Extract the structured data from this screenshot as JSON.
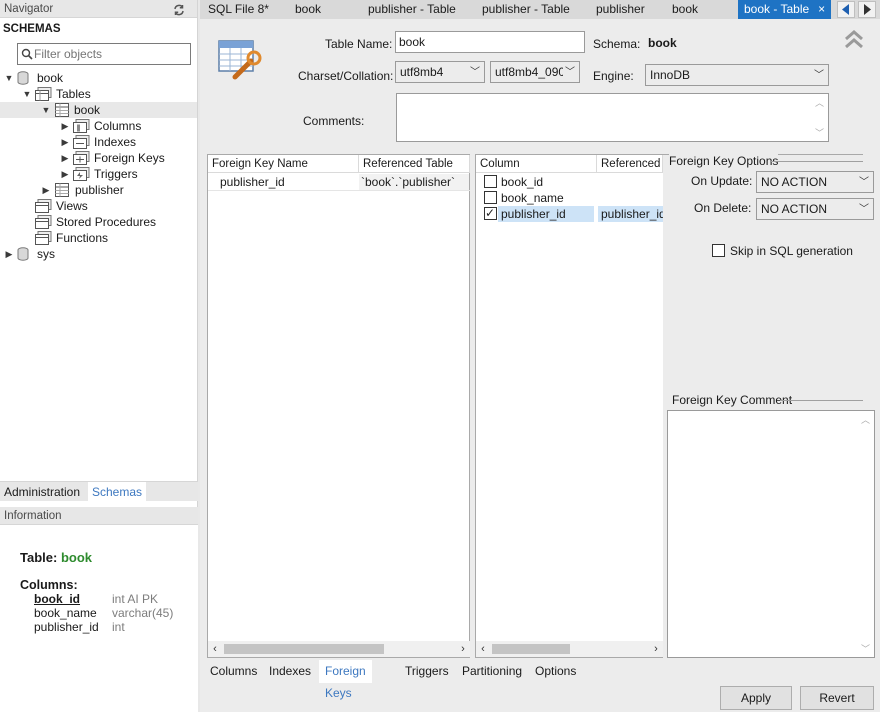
{
  "navigator": {
    "title": "Navigator",
    "schemas_label": "SCHEMAS",
    "filter_placeholder": "Filter objects",
    "tree": {
      "book": "book",
      "tables": "Tables",
      "book_table": "book",
      "columns": "Columns",
      "indexes": "Indexes",
      "foreign_keys": "Foreign Keys",
      "triggers": "Triggers",
      "publisher": "publisher",
      "views": "Views",
      "stored_procedures": "Stored Procedures",
      "functions": "Functions",
      "sys": "sys"
    },
    "bottom_tabs": [
      "Administration",
      "Schemas"
    ],
    "information_title": "Information",
    "info": {
      "table_prefix": "Table: ",
      "table_name": "book",
      "columns_label": "Columns:",
      "columns": [
        {
          "name": "book_id",
          "type": "int AI PK"
        },
        {
          "name": "book_name",
          "type": "varchar(45)"
        },
        {
          "name": "publisher_id",
          "type": "int"
        }
      ]
    }
  },
  "tabs": [
    "SQL File 8*",
    "book",
    "publisher - Table",
    "publisher - Table",
    "publisher",
    "book",
    "book - Table"
  ],
  "tab_close": "×",
  "editor": {
    "table_name_label": "Table Name:",
    "table_name_value": "book",
    "schema_label": "Schema:",
    "schema_value": "book",
    "charset_label": "Charset/Collation:",
    "charset_value": "utf8mb4",
    "collation_value": "utf8mb4_090(",
    "engine_label": "Engine:",
    "engine_value": "InnoDB",
    "comments_label": "Comments:",
    "fk_grid": {
      "headers": [
        "Foreign Key Name",
        "Referenced Table"
      ],
      "rows": [
        [
          "publisher_id",
          "`book`.`publisher`"
        ]
      ]
    },
    "col_grid": {
      "headers": [
        "Column",
        "Referenced C"
      ],
      "rows": [
        {
          "column": "book_id",
          "checked": false,
          "ref": ""
        },
        {
          "column": "book_name",
          "checked": false,
          "ref": ""
        },
        {
          "column": "publisher_id",
          "checked": true,
          "ref": "publisher_id"
        }
      ]
    },
    "fk_options_title": "Foreign Key Options",
    "on_update_label": "On Update:",
    "on_update_value": "NO ACTION",
    "on_delete_label": "On Delete:",
    "on_delete_value": "NO ACTION",
    "skip_label": "Skip in SQL generation",
    "fk_comment_title": "Foreign Key Comment",
    "sub_tabs": [
      "Columns",
      "Indexes",
      "Foreign Keys",
      "Triggers",
      "Partitioning",
      "Options"
    ],
    "apply_label": "Apply",
    "revert_label": "Revert"
  },
  "colors": {
    "active_tab": "#1e73c4",
    "link_blue": "#3d78c0",
    "table_name_green": "#2e8b2e",
    "selected_cell": "#cde3f7"
  }
}
